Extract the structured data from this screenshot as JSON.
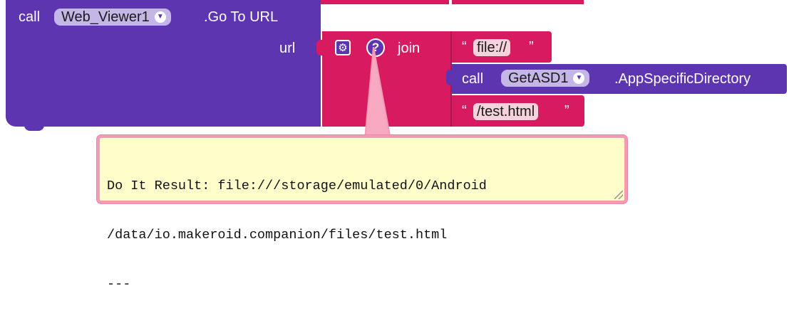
{
  "call_block": {
    "call_label": "call",
    "component": "Web_Viewer1",
    "method": ".Go To URL",
    "url_label": "url",
    "color": "#5e35b1"
  },
  "join_block": {
    "label": "join",
    "gear_icon": "gear-icon",
    "help_icon": "help-icon",
    "help_glyph": "?",
    "color": "#d81b60"
  },
  "string1": {
    "open_quote": "“",
    "value": "file://",
    "close_quote": "”"
  },
  "inner_call": {
    "call_label": "call",
    "component": "GetASD1",
    "method": ".AppSpecificDirectory"
  },
  "string2": {
    "open_quote": "“",
    "value": "/test.html",
    "close_quote": "”"
  },
  "result": {
    "line1": "Do It Result: file:///storage/emulated/0/Android",
    "line2": "/data/io.makeroid.companion/files/test.html",
    "line3": "---"
  }
}
